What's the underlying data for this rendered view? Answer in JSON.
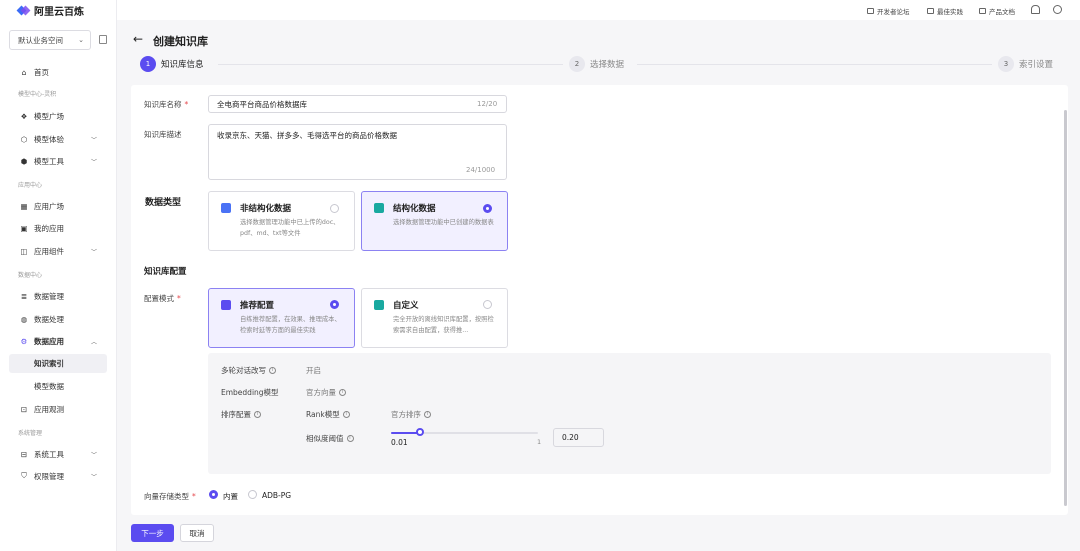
{
  "app": {
    "name": "阿里云百炼",
    "workspace": "默认业务空间",
    "accent": "#5b4cf0"
  },
  "topbar": {
    "links": [
      "开发者论坛",
      "最佳实践",
      "产品文档"
    ]
  },
  "sidebar": {
    "home": "首页",
    "sec_model": "模型中心-灵积",
    "model_square": "模型广场",
    "model_exp": "模型体验",
    "model_tools": "模型工具",
    "sec_app": "应用中心",
    "app_square": "应用广场",
    "my_apps": "我的应用",
    "app_components": "应用组件",
    "sec_data": "数据中心",
    "data_mgmt": "数据管理",
    "data_proc": "数据处理",
    "data_app": "数据应用",
    "kb_index": "知识索引",
    "model_data": "模型数据",
    "app_observe": "应用观测",
    "sec_sys": "系统管理",
    "sys_tools": "系统工具",
    "perm_mgmt": "权限管理"
  },
  "page": {
    "title": "创建知识库"
  },
  "steps": [
    {
      "num": "1",
      "label": "知识库信息"
    },
    {
      "num": "2",
      "label": "选择数据"
    },
    {
      "num": "3",
      "label": "索引设置"
    }
  ],
  "form": {
    "name_label": "知识库名称",
    "name_value": "全电商平台商品价格数据库",
    "name_count": "12/20",
    "desc_label": "知识库描述",
    "desc_value": "收录京东、天猫、拼多多、毛得选平台的商品价格数据",
    "desc_count": "24/1000",
    "data_type_title": "数据类型",
    "unstructured_title": "非结构化数据",
    "unstructured_desc": "选择数据管理功能中已上传的doc、pdf、md、txt等文件",
    "structured_title": "结构化数据",
    "structured_desc": "选择数据管理功能中已创建的数据表",
    "kb_config_title": "知识库配置",
    "mode_label": "配置模式",
    "recommend_title": "推荐配置",
    "recommend_desc": "自练推荐配置，在效果、推理成本、检索时延等方面的最佳实践",
    "custom_title": "自定义",
    "custom_desc": "完全开放的离线知识库配置，按照检索需求自由配置，获得推...",
    "rewrite_label": "多轮对话改写",
    "rewrite_value": "开启",
    "embedding_label": "Embedding模型",
    "embedding_value": "官方向量",
    "rank_label": "排序配置",
    "rank_model_label": "Rank模型",
    "rank_model_value": "官方排序",
    "sim_label": "相似度阈值",
    "sim_min": "0.01",
    "sim_max": "1",
    "sim_value": "0.20",
    "sim_fraction": 0.2,
    "store_label": "向量存储类型",
    "store_builtin": "内置",
    "store_adb": "ADB-PG"
  },
  "buttons": {
    "next": "下一步",
    "cancel": "取消"
  }
}
